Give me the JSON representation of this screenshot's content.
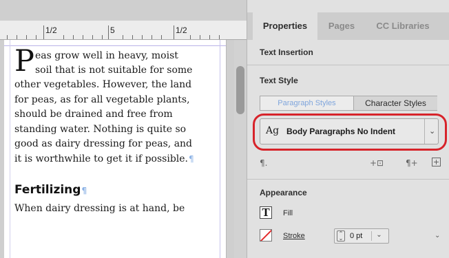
{
  "ruler": {
    "labels": [
      "1/2",
      "5",
      "1/2"
    ]
  },
  "document": {
    "drop_cap": "P",
    "lines": [
      "eas grow well in heavy, moist",
      "soil that is not suitable for some",
      "other vegetables. However, the land",
      "for peas, as for all vegetable plants,",
      "should be drained and free from",
      "standing water. Nothing is quite so",
      "good as dairy dressing for peas, and",
      "it is worthwhile to get it if possible."
    ],
    "heading": "Fertilizing",
    "after_heading": "When dairy dressing is at hand, be",
    "pilcrow": "¶"
  },
  "panel": {
    "tabs": [
      {
        "label": "Properties",
        "active": true
      },
      {
        "label": "Pages",
        "active": false
      },
      {
        "label": "CC Libraries",
        "active": false
      }
    ],
    "text_insertion_title": "Text Insertion",
    "text_style_title": "Text Style",
    "paragraph_styles_label": "Paragraph Styles",
    "character_styles_label": "Character Styles",
    "style_dropdown": {
      "icon_text": "Ag",
      "value": "Body Paragraphs No Indent"
    },
    "toolbar": {
      "pilcrow_icon": "¶.",
      "clear_overrides_icon": "+⊡",
      "para_override_icon": "¶+",
      "new_style_icon": "+"
    },
    "appearance": {
      "title": "Appearance",
      "fill_label": "Fill",
      "fill_icon_text": "T",
      "stroke_label": "Stroke",
      "stroke_weight": "0 pt"
    }
  },
  "colors": {
    "highlight": "#d7232a",
    "paragraph_styles_text": "#7fa5dc",
    "stroke_slash": "#e32b2b"
  }
}
